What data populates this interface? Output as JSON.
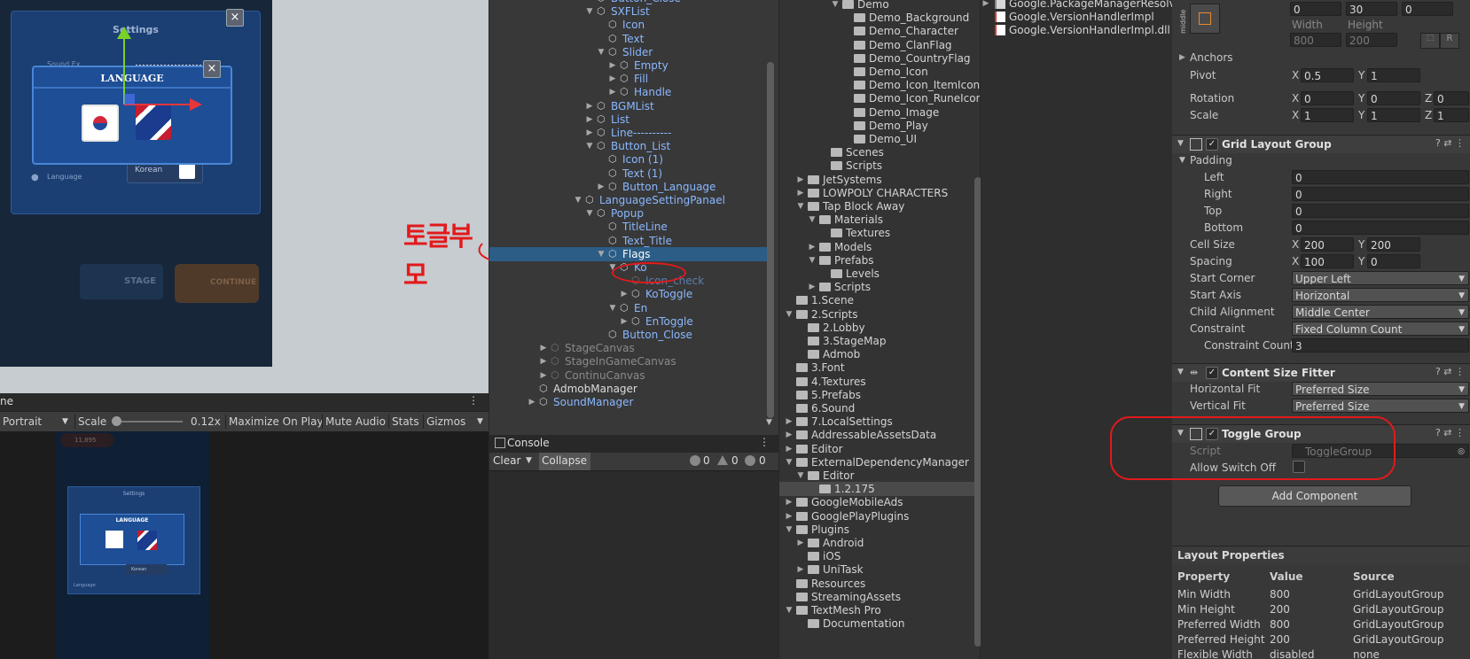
{
  "scene": {
    "settings_title": "Settings",
    "language_title": "LANGUAGE",
    "sound_label": "Sound Ex",
    "language_label": "Language",
    "korean_btn": "Korean",
    "stage_btn": "STAGE",
    "continue_btn": "CONTINUE",
    "annotation": "토글부모"
  },
  "game_toolbar": {
    "tab": "ne",
    "aspect": "Portrait",
    "scale_label": "Scale",
    "scale_value": "0.12x",
    "maximize": "Maximize On Play",
    "mute": "Mute Audio",
    "stats": "Stats",
    "gizmos": "Gizmos"
  },
  "mini_game": {
    "settings_title": "Settings",
    "language_title": "LANGUAGE",
    "korean_btn": "Korean",
    "language_label": "Language",
    "score": "11,895"
  },
  "hierarchy": {
    "rows": [
      {
        "label": "Button_Close",
        "depth": 9,
        "arrow": "",
        "dim": false,
        "sel": false
      },
      {
        "label": "SXFList",
        "depth": 9,
        "arrow": "down",
        "dim": false,
        "sel": false
      },
      {
        "label": "Icon",
        "depth": 10,
        "arrow": "",
        "dim": false,
        "sel": false
      },
      {
        "label": "Text",
        "depth": 10,
        "arrow": "",
        "dim": false,
        "sel": false
      },
      {
        "label": "Slider",
        "depth": 10,
        "arrow": "down",
        "dim": false,
        "sel": false
      },
      {
        "label": "Empty",
        "depth": 11,
        "arrow": "right",
        "dim": false,
        "sel": false
      },
      {
        "label": "Fill",
        "depth": 11,
        "arrow": "right",
        "dim": false,
        "sel": false
      },
      {
        "label": "Handle",
        "depth": 11,
        "arrow": "right",
        "dim": false,
        "sel": false
      },
      {
        "label": "BGMList",
        "depth": 9,
        "arrow": "right",
        "dim": false,
        "sel": false
      },
      {
        "label": "List",
        "depth": 9,
        "arrow": "right",
        "dim": false,
        "sel": false
      },
      {
        "label": "Line----------",
        "depth": 9,
        "arrow": "right",
        "dim": false,
        "sel": false
      },
      {
        "label": "Button_List",
        "depth": 9,
        "arrow": "down",
        "dim": false,
        "sel": false
      },
      {
        "label": "Icon (1)",
        "depth": 10,
        "arrow": "",
        "dim": false,
        "sel": false
      },
      {
        "label": "Text (1)",
        "depth": 10,
        "arrow": "",
        "dim": false,
        "sel": false
      },
      {
        "label": "Button_Language",
        "depth": 10,
        "arrow": "right",
        "dim": false,
        "sel": false
      },
      {
        "label": "LanguageSettingPanael",
        "depth": 8,
        "arrow": "down",
        "dim": false,
        "sel": false
      },
      {
        "label": "Popup",
        "depth": 9,
        "arrow": "down",
        "dim": false,
        "sel": false
      },
      {
        "label": "TitleLine",
        "depth": 10,
        "arrow": "",
        "dim": false,
        "sel": false
      },
      {
        "label": "Text_Title",
        "depth": 10,
        "arrow": "",
        "dim": false,
        "sel": false
      },
      {
        "label": "Flags",
        "depth": 10,
        "arrow": "down",
        "dim": false,
        "sel": true
      },
      {
        "label": "Ko",
        "depth": 11,
        "arrow": "down",
        "dim": false,
        "sel": false
      },
      {
        "label": "Icon_check",
        "depth": 12,
        "arrow": "",
        "dim": true,
        "sel": false
      },
      {
        "label": "KoToggle",
        "depth": 12,
        "arrow": "right",
        "dim": false,
        "sel": false
      },
      {
        "label": "En",
        "depth": 11,
        "arrow": "down",
        "dim": false,
        "sel": false
      },
      {
        "label": "EnToggle",
        "depth": 12,
        "arrow": "right",
        "dim": false,
        "sel": false
      },
      {
        "label": "Button_Close",
        "depth": 10,
        "arrow": "",
        "dim": false,
        "sel": false
      },
      {
        "label": "StageCanvas",
        "depth": 5,
        "arrow": "right",
        "dim": true,
        "sel": false
      },
      {
        "label": "StageInGameCanvas",
        "depth": 5,
        "arrow": "right",
        "dim": true,
        "sel": false
      },
      {
        "label": "ContinuCanvas",
        "depth": 5,
        "arrow": "right",
        "dim": true,
        "sel": false
      },
      {
        "label": "AdmobManager",
        "depth": 4,
        "arrow": "",
        "dim": false,
        "sel": false
      },
      {
        "label": "SoundManager",
        "depth": 4,
        "arrow": "right",
        "dim": false,
        "sel": false
      }
    ]
  },
  "console": {
    "tab": "Console",
    "clear": "Clear",
    "collapse": "Collapse",
    "count_info": "0",
    "count_warn": "0",
    "count_error": "0"
  },
  "project": {
    "rows": [
      {
        "label": "Demo",
        "depth": 5,
        "arrow": "down",
        "sel": false
      },
      {
        "label": "Demo_Background",
        "depth": 6,
        "arrow": "",
        "sel": false
      },
      {
        "label": "Demo_Character",
        "depth": 6,
        "arrow": "",
        "sel": false
      },
      {
        "label": "Demo_ClanFlag",
        "depth": 6,
        "arrow": "",
        "sel": false
      },
      {
        "label": "Demo_CountryFlag",
        "depth": 6,
        "arrow": "",
        "sel": false
      },
      {
        "label": "Demo_Icon",
        "depth": 6,
        "arrow": "",
        "sel": false
      },
      {
        "label": "Demo_Icon_ItemIcon",
        "depth": 6,
        "arrow": "",
        "sel": false
      },
      {
        "label": "Demo_Icon_RuneIcon",
        "depth": 6,
        "arrow": "",
        "sel": false
      },
      {
        "label": "Demo_Image",
        "depth": 6,
        "arrow": "",
        "sel": false
      },
      {
        "label": "Demo_Play",
        "depth": 6,
        "arrow": "",
        "sel": false
      },
      {
        "label": "Demo_UI",
        "depth": 6,
        "arrow": "",
        "sel": false
      },
      {
        "label": "Scenes",
        "depth": 4,
        "arrow": "",
        "sel": false
      },
      {
        "label": "Scripts",
        "depth": 4,
        "arrow": "",
        "sel": false
      },
      {
        "label": "JetSystems",
        "depth": 2,
        "arrow": "right",
        "sel": false
      },
      {
        "label": "LOWPOLY CHARACTERS",
        "depth": 2,
        "arrow": "right",
        "sel": false
      },
      {
        "label": "Tap Block Away",
        "depth": 2,
        "arrow": "down",
        "sel": false
      },
      {
        "label": "Materials",
        "depth": 3,
        "arrow": "down",
        "sel": false
      },
      {
        "label": "Textures",
        "depth": 4,
        "arrow": "",
        "sel": false
      },
      {
        "label": "Models",
        "depth": 3,
        "arrow": "right",
        "sel": false
      },
      {
        "label": "Prefabs",
        "depth": 3,
        "arrow": "down",
        "sel": false
      },
      {
        "label": "Levels",
        "depth": 4,
        "arrow": "",
        "sel": false
      },
      {
        "label": "Scripts",
        "depth": 3,
        "arrow": "right",
        "sel": false
      },
      {
        "label": "1.Scene",
        "depth": 1,
        "arrow": "",
        "sel": false
      },
      {
        "label": "2.Scripts",
        "depth": 1,
        "arrow": "down",
        "sel": false
      },
      {
        "label": "2.Lobby",
        "depth": 2,
        "arrow": "",
        "sel": false
      },
      {
        "label": "3.StageMap",
        "depth": 2,
        "arrow": "",
        "sel": false
      },
      {
        "label": "Admob",
        "depth": 2,
        "arrow": "",
        "sel": false
      },
      {
        "label": "3.Font",
        "depth": 1,
        "arrow": "",
        "sel": false
      },
      {
        "label": "4.Textures",
        "depth": 1,
        "arrow": "",
        "sel": false
      },
      {
        "label": "5.Prefabs",
        "depth": 1,
        "arrow": "",
        "sel": false
      },
      {
        "label": "6.Sound",
        "depth": 1,
        "arrow": "",
        "sel": false
      },
      {
        "label": "7.LocalSettings",
        "depth": 1,
        "arrow": "right",
        "sel": false
      },
      {
        "label": "AddressableAssetsData",
        "depth": 1,
        "arrow": "right",
        "sel": false
      },
      {
        "label": "Editor",
        "depth": 1,
        "arrow": "right",
        "sel": false
      },
      {
        "label": "ExternalDependencyManager",
        "depth": 1,
        "arrow": "down",
        "sel": false
      },
      {
        "label": "Editor",
        "depth": 2,
        "arrow": "down",
        "sel": false
      },
      {
        "label": "1.2.175",
        "depth": 3,
        "arrow": "",
        "sel": true
      },
      {
        "label": "GoogleMobileAds",
        "depth": 1,
        "arrow": "right",
        "sel": false
      },
      {
        "label": "GooglePlayPlugins",
        "depth": 1,
        "arrow": "right",
        "sel": false
      },
      {
        "label": "Plugins",
        "depth": 1,
        "arrow": "down",
        "sel": false
      },
      {
        "label": "Android",
        "depth": 2,
        "arrow": "right",
        "sel": false
      },
      {
        "label": "iOS",
        "depth": 2,
        "arrow": "",
        "sel": false
      },
      {
        "label": "UniTask",
        "depth": 2,
        "arrow": "right",
        "sel": false
      },
      {
        "label": "Resources",
        "depth": 1,
        "arrow": "",
        "sel": false
      },
      {
        "label": "StreamingAssets",
        "depth": 1,
        "arrow": "",
        "sel": false
      },
      {
        "label": "TextMesh Pro",
        "depth": 1,
        "arrow": "down",
        "sel": false
      },
      {
        "label": "Documentation",
        "depth": 2,
        "arrow": "",
        "sel": false
      }
    ]
  },
  "assets": {
    "items": [
      {
        "label": "Google.PackageManagerResolver",
        "arrow": "right"
      },
      {
        "label": "Google.VersionHandlerImpl",
        "arrow": ""
      },
      {
        "label": "Google.VersionHandlerImpl.dll",
        "arrow": ""
      }
    ]
  },
  "inspector": {
    "anchor_preset": "middle",
    "pos_values": [
      "0",
      "30",
      "0"
    ],
    "width_label": "Width",
    "height_label": "Height",
    "width_value": "800",
    "height_value": "200",
    "anchors": "Anchors",
    "pivot": {
      "label": "Pivot",
      "x": "0.5",
      "y": "1"
    },
    "rotation": {
      "label": "Rotation",
      "x": "0",
      "y": "0",
      "z": "0"
    },
    "scale": {
      "label": "Scale",
      "x": "1",
      "y": "1",
      "z": "1"
    },
    "axis_x": "X",
    "axis_y": "Y",
    "axis_z": "Z",
    "grid": {
      "title": "Grid Layout Group",
      "padding": "Padding",
      "left_label": "Left",
      "left": "0",
      "right_label": "Right",
      "right": "0",
      "top_label": "Top",
      "top": "0",
      "bottom_label": "Bottom",
      "bottom": "0",
      "cell_label": "Cell Size",
      "cell_x": "200",
      "cell_y": "200",
      "spacing_label": "Spacing",
      "spacing_x": "100",
      "spacing_y": "0",
      "start_corner_label": "Start Corner",
      "start_corner": "Upper Left",
      "start_axis_label": "Start Axis",
      "start_axis": "Horizontal",
      "child_align_label": "Child Alignment",
      "child_align": "Middle Center",
      "constraint_label": "Constraint",
      "constraint": "Fixed Column Count",
      "constraint_count_label": "Constraint Count",
      "constraint_count": "3"
    },
    "fitter": {
      "title": "Content Size Fitter",
      "h_label": "Horizontal Fit",
      "h_value": "Preferred Size",
      "v_label": "Vertical Fit",
      "v_value": "Preferred Size"
    },
    "toggle_group": {
      "title": "Toggle Group",
      "script_label": "Script",
      "script_value": "ToggleGroup",
      "allow_label": "Allow Switch Off"
    },
    "add_component": "Add Component",
    "layout_props": {
      "title": "Layout Properties",
      "headers": [
        "Property",
        "Value",
        "Source"
      ],
      "rows": [
        [
          "Min Width",
          "800",
          "GridLayoutGroup"
        ],
        [
          "Min Height",
          "200",
          "GridLayoutGroup"
        ],
        [
          "Preferred Width",
          "800",
          "GridLayoutGroup"
        ],
        [
          "Preferred Height",
          "200",
          "GridLayoutGroup"
        ],
        [
          "Flexible Width",
          "disabled",
          "none"
        ]
      ]
    }
  }
}
